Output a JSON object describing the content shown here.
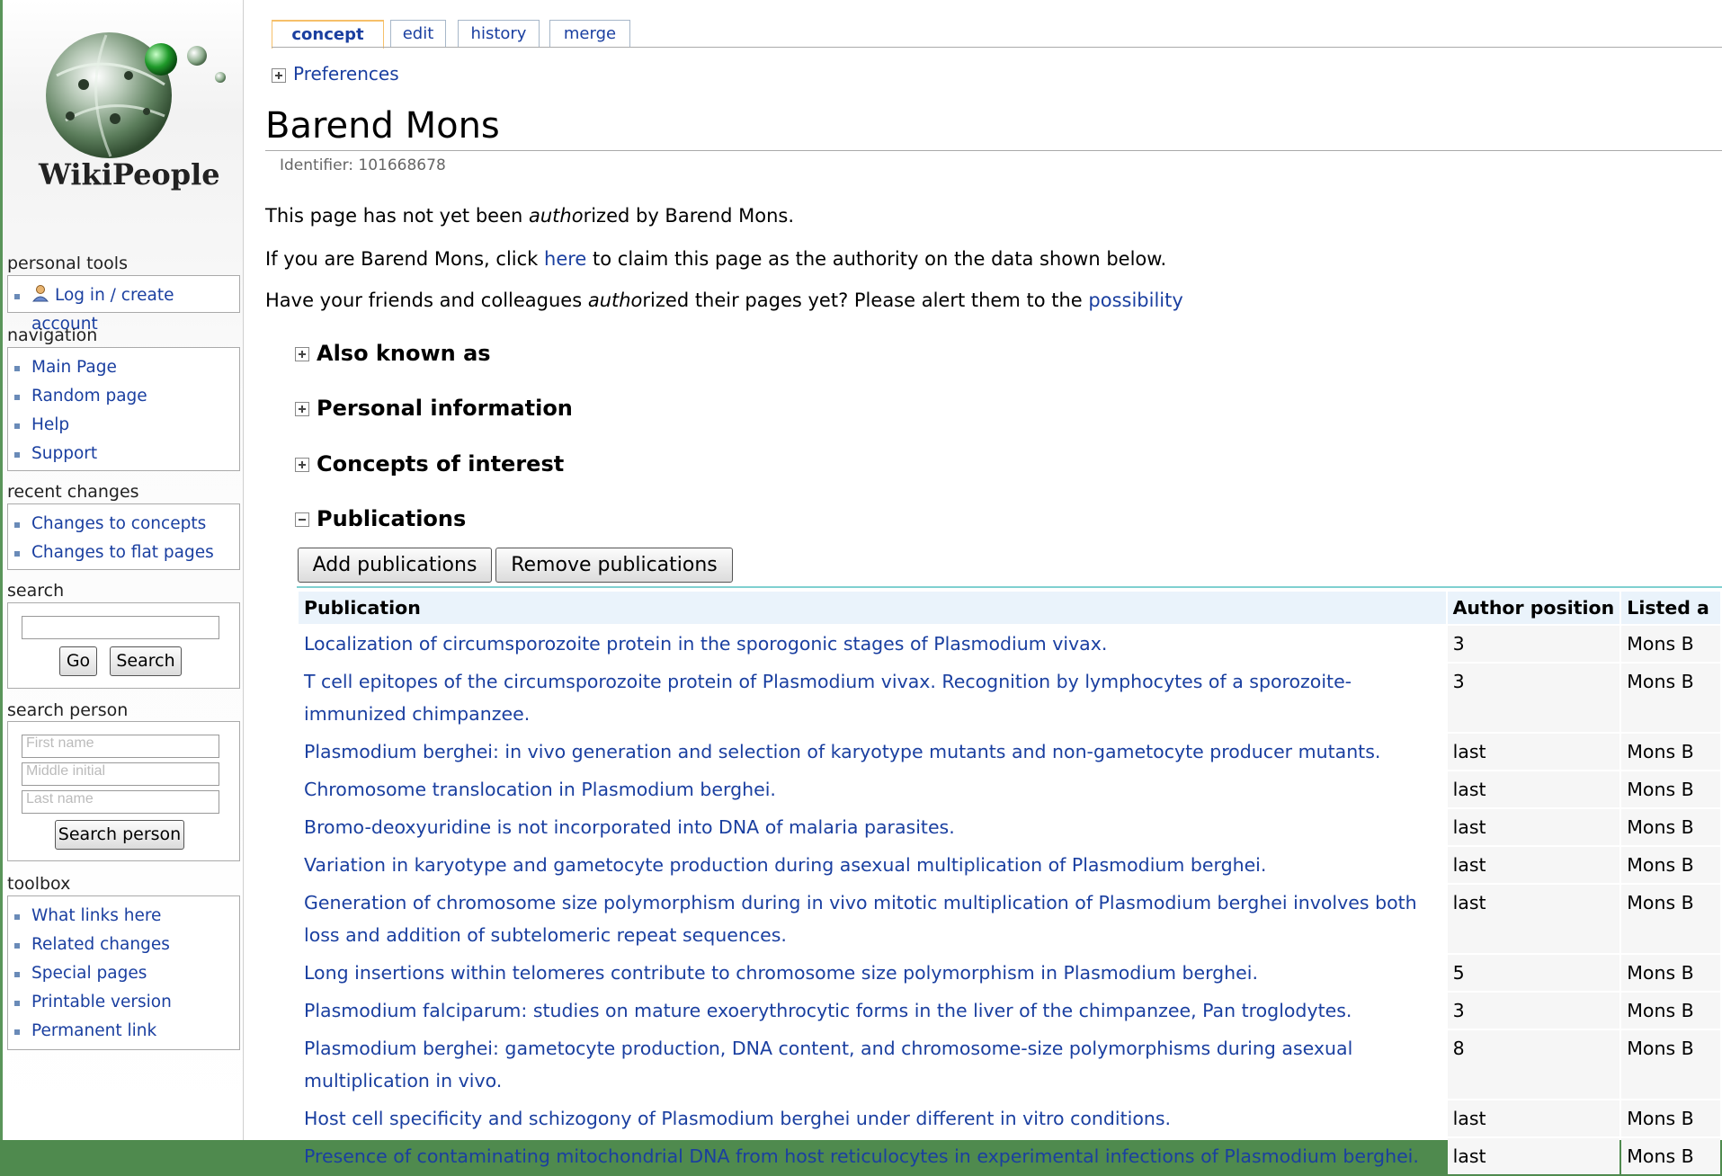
{
  "site": {
    "name": "WikiPeople"
  },
  "sidebar": {
    "personal_tools": {
      "title": "personal tools",
      "login": "Log in / create account"
    },
    "navigation": {
      "title": "navigation",
      "items": [
        "Main Page",
        "Random page",
        "Help",
        "Support"
      ]
    },
    "recent_changes": {
      "title": "recent changes",
      "items": [
        "Changes to concepts",
        "Changes to flat pages"
      ]
    },
    "search": {
      "title": "search",
      "go": "Go",
      "search": "Search"
    },
    "search_person": {
      "title": "search person",
      "first_placeholder": "First name",
      "middle_placeholder": "Middle initial",
      "last_placeholder": "Last name",
      "button": "Search person"
    },
    "toolbox": {
      "title": "toolbox",
      "items": [
        "What links here",
        "Related changes",
        "Special pages",
        "Printable version",
        "Permanent link"
      ]
    }
  },
  "tabs": [
    "concept",
    "edit",
    "history",
    "merge"
  ],
  "preferences": "Preferences",
  "page": {
    "title": "Barend Mons",
    "identifier": "Identifier: 101668678",
    "line1": {
      "a": "This page has not yet been ",
      "em": "autho",
      "b": "rized by Barend Mons."
    },
    "line2": {
      "a": "If you are Barend Mons, click ",
      "link": "here",
      "b": " to claim this page as the authority on the data shown below."
    },
    "line3": {
      "a": "Have your friends and colleagues ",
      "em": "autho",
      "b": "rized their pages yet? Please alert them to the ",
      "link": "possibility"
    }
  },
  "sections": [
    "Also known as",
    "Personal information",
    "Concepts of interest",
    "Publications"
  ],
  "publications": {
    "add": "Add publications",
    "remove": "Remove publications",
    "headers": {
      "publication": "Publication",
      "position": "Author position",
      "listed": "Listed a"
    },
    "rows": [
      {
        "title": "Localization of circumsporozoite protein in the sporogonic stages of Plasmodium vivax.",
        "position": "3",
        "listed": "Mons B"
      },
      {
        "title": "T cell epitopes of the circumsporozoite protein of Plasmodium vivax. Recognition by lymphocytes of a sporozoite-immunized chimpanzee.",
        "position": "3",
        "listed": "Mons B"
      },
      {
        "title": "Plasmodium berghei: in vivo generation and selection of karyotype mutants and non-gametocyte producer mutants.",
        "position": "last",
        "listed": "Mons B"
      },
      {
        "title": "Chromosome translocation in Plasmodium berghei.",
        "position": "last",
        "listed": "Mons B"
      },
      {
        "title": "Bromo-deoxyuridine is not incorporated into DNA of malaria parasites.",
        "position": "last",
        "listed": "Mons B"
      },
      {
        "title": "Variation in karyotype and gametocyte production during asexual multiplication of Plasmodium berghei.",
        "position": "last",
        "listed": "Mons B"
      },
      {
        "title": "Generation of chromosome size polymorphism during in vivo mitotic multiplication of Plasmodium berghei involves both loss and addition of subtelomeric repeat sequences.",
        "position": "last",
        "listed": "Mons B"
      },
      {
        "title": "Long insertions within telomeres contribute to chromosome size polymorphism in Plasmodium berghei.",
        "position": "5",
        "listed": "Mons B"
      },
      {
        "title": "Plasmodium falciparum: studies on mature exoerythrocytic forms in the liver of the chimpanzee, Pan troglodytes.",
        "position": "3",
        "listed": "Mons B"
      },
      {
        "title": "Plasmodium berghei: gametocyte production, DNA content, and chromosome-size polymorphisms during asexual multiplication in vivo.",
        "position": "8",
        "listed": "Mons B"
      },
      {
        "title": "Host cell specificity and schizogony of Plasmodium berghei under different in vitro conditions.",
        "position": "last",
        "listed": "Mons B"
      },
      {
        "title": "Presence of contaminating mitochondrial DNA from host reticulocytes in experimental infections of Plasmodium berghei.",
        "position": "last",
        "listed": "Mons B"
      }
    ]
  }
}
